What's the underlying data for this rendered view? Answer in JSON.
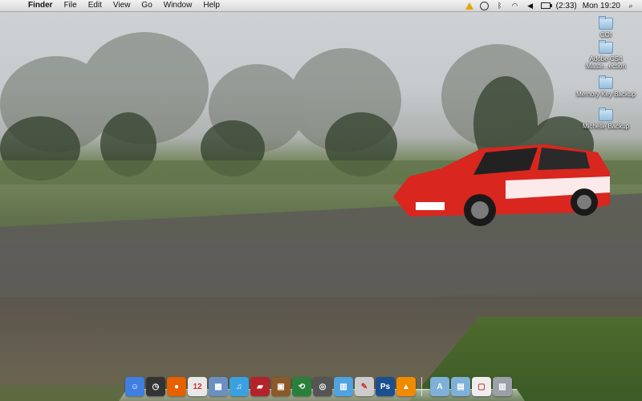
{
  "menubar": {
    "apple_glyph": "",
    "app_name": "Finder",
    "menus": [
      "File",
      "Edit",
      "View",
      "Go",
      "Window",
      "Help"
    ],
    "battery_text": "(2:33)",
    "clock": "Mon 19:20",
    "status_icons": [
      "warning-icon",
      "time-machine-icon",
      "bluetooth-icon",
      "wifi-icon",
      "volume-icon",
      "battery-icon",
      "spotlight-icon"
    ]
  },
  "desktop": {
    "items": [
      {
        "label": "COI"
      },
      {
        "label": "Adobe CS4 Maste...ection"
      },
      {
        "label": "Memory Key Backup"
      },
      {
        "label": "Michelle Backup"
      }
    ]
  },
  "dock": {
    "apps": [
      {
        "name": "finder",
        "glyph": "☺",
        "color": "#3f7fe0"
      },
      {
        "name": "dashboard",
        "glyph": "◷",
        "color": "#333333"
      },
      {
        "name": "firefox",
        "glyph": "●",
        "color": "#e66000"
      },
      {
        "name": "ical",
        "glyph": "12",
        "color": "#e8e8e8"
      },
      {
        "name": "preview",
        "glyph": "▦",
        "color": "#6a8fc0"
      },
      {
        "name": "itunes",
        "glyph": "♫",
        "color": "#3aa0e0"
      },
      {
        "name": "guitar",
        "glyph": "▰",
        "color": "#b2242a"
      },
      {
        "name": "iphoto",
        "glyph": "▣",
        "color": "#8b5a2b"
      },
      {
        "name": "time-machine",
        "glyph": "⟲",
        "color": "#2a7f3a"
      },
      {
        "name": "image-capture",
        "glyph": "◎",
        "color": "#555555"
      },
      {
        "name": "ilife",
        "glyph": "▥",
        "color": "#4fa3e0"
      },
      {
        "name": "script-editor",
        "glyph": "✎",
        "color": "#cccccc"
      },
      {
        "name": "photoshop",
        "glyph": "Ps",
        "color": "#1c4f8f"
      },
      {
        "name": "vlc",
        "glyph": "▲",
        "color": "#f08a00"
      }
    ],
    "right": [
      {
        "name": "applications-folder",
        "glyph": "A",
        "color": "#7fb0d8"
      },
      {
        "name": "documents-folder",
        "glyph": "▤",
        "color": "#7fb0d8"
      },
      {
        "name": "document-stack",
        "glyph": "▢",
        "color": "#eeeeee"
      },
      {
        "name": "trash",
        "glyph": "▥",
        "color": "#9aa0a6"
      }
    ]
  }
}
